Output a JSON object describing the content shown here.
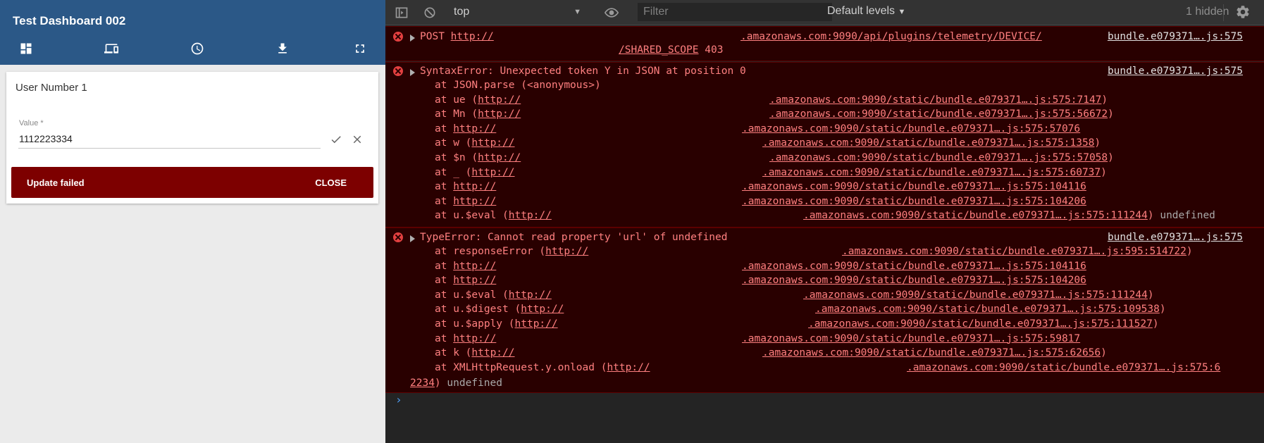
{
  "app": {
    "title": "Test Dashboard 002",
    "toolbar_icons": [
      "dashboard-icon",
      "devices-icon",
      "history-icon",
      "download-icon",
      "fullscreen-icon"
    ]
  },
  "card": {
    "title": "User Number 1",
    "value_label": "Value *",
    "value": "1112223334",
    "snackbar_message": "Update failed",
    "snackbar_action": "CLOSE",
    "snackbar_color": "#7d0000"
  },
  "devtools": {
    "context": "top",
    "filter_placeholder": "Filter",
    "levels": "Default levels",
    "hidden": "1 hidden",
    "accent_error": "#ff8080"
  },
  "console": {
    "post": {
      "prefix": "POST ",
      "url_start": "http://",
      "url_end": ".amazonaws.com:9090/api/plugins/telemetry/DEVICE/",
      "url_cont": "/SHARED_SCOPE",
      "status": " 403",
      "source": "bundle.e079371….js:575"
    },
    "syntax_error": {
      "message": "SyntaxError: Unexpected token Y in JSON at position 0",
      "source": "bundle.e079371….js:575",
      "frames": [
        {
          "fn": "at JSON.parse (",
          "pre": "",
          "link": "",
          "rest": "<anonymous>)"
        },
        {
          "fn": "at ue (",
          "pre": "http://",
          "link": ".amazonaws.com:9090/static/bundle.e079371….js:575:7147",
          "rest": ")"
        },
        {
          "fn": "at Mn (",
          "pre": "http://",
          "link": ".amazonaws.com:9090/static/bundle.e079371….js:575:56672",
          "rest": ")"
        },
        {
          "fn": "at ",
          "pre": "http://",
          "link": ".amazonaws.com:9090/static/bundle.e079371….js:575:57076",
          "rest": ""
        },
        {
          "fn": "at w (",
          "pre": "http://",
          "link": ".amazonaws.com:9090/static/bundle.e079371….js:575:1358",
          "rest": ")"
        },
        {
          "fn": "at $n (",
          "pre": "http://",
          "link": ".amazonaws.com:9090/static/bundle.e079371….js:575:57058",
          "rest": ")"
        },
        {
          "fn": "at _ (",
          "pre": "http://",
          "link": ".amazonaws.com:9090/static/bundle.e079371….js:575:60737",
          "rest": ")"
        },
        {
          "fn": "at ",
          "pre": "http://",
          "link": ".amazonaws.com:9090/static/bundle.e079371….js:575:104116",
          "rest": ""
        },
        {
          "fn": "at ",
          "pre": "http://",
          "link": ".amazonaws.com:9090/static/bundle.e079371….js:575:104206",
          "rest": ""
        },
        {
          "fn": "at u.$eval (",
          "pre": "http://",
          "link": ".amazonaws.com:9090/static/bundle.e079371….js:575:111244",
          "rest": ")",
          "trail": " undefined"
        }
      ]
    },
    "type_error": {
      "message": "TypeError: Cannot read property 'url' of undefined",
      "source": "bundle.e079371….js:575",
      "frames": [
        {
          "fn": "at responseError (",
          "pre": "http://",
          "link": ".amazonaws.com:9090/static/bundle.e079371….js:595:514722",
          "rest": ")"
        },
        {
          "fn": "at ",
          "pre": "http://",
          "link": ".amazonaws.com:9090/static/bundle.e079371….js:575:104116",
          "rest": ""
        },
        {
          "fn": "at ",
          "pre": "http://",
          "link": ".amazonaws.com:9090/static/bundle.e079371….js:575:104206",
          "rest": ""
        },
        {
          "fn": "at u.$eval (",
          "pre": "http://",
          "link": ".amazonaws.com:9090/static/bundle.e079371….js:575:111244",
          "rest": ")"
        },
        {
          "fn": "at u.$digest (",
          "pre": "http://",
          "link": ".amazonaws.com:9090/static/bundle.e079371….js:575:109538",
          "rest": ")"
        },
        {
          "fn": "at u.$apply (",
          "pre": "http://",
          "link": ".amazonaws.com:9090/static/bundle.e079371….js:575:111527",
          "rest": ")"
        },
        {
          "fn": "at ",
          "pre": "http://",
          "link": ".amazonaws.com:9090/static/bundle.e079371….js:575:59817",
          "rest": ""
        },
        {
          "fn": "at k (",
          "pre": "http://",
          "link": ".amazonaws.com:9090/static/bundle.e079371….js:575:62656",
          "rest": ")"
        },
        {
          "fn": "at XMLHttpRequest.y.onload (",
          "pre": "http://",
          "link": ".amazonaws.com:9090/static/bundle.e079371….js:575:6",
          "rest": ""
        }
      ],
      "wrap_link": "2234",
      "wrap_rest": ")",
      "wrap_trail": " undefined"
    },
    "prompt": "›"
  }
}
